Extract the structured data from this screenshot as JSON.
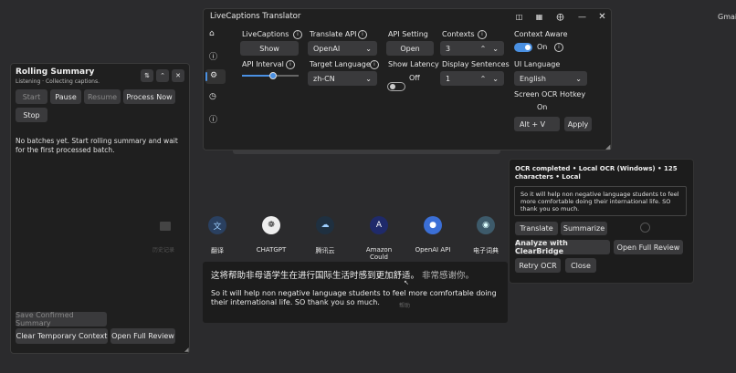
{
  "desktop": {
    "corner_text": "Gmai"
  },
  "translator": {
    "title": "LiveCaptions Translator",
    "livecaptions_label": "LiveCaptions",
    "livecaptions_button": "Show",
    "translate_api_label": "Translate API",
    "translate_api_value": "OpenAI",
    "api_setting_label": "API Setting",
    "api_setting_button": "Open",
    "contexts_label": "Contexts",
    "contexts_value": "3",
    "context_aware_label": "Context Aware",
    "context_aware_state": "On",
    "api_interval_label": "API Interval",
    "api_interval_level": 0.55,
    "target_language_label": "Target Language",
    "target_language_value": "zh-CN",
    "show_latency_label": "Show Latency",
    "show_latency_state": "Off",
    "display_sentences_label": "Display Sentences",
    "display_sentences_value": "1",
    "ui_language_label": "UI Language",
    "ui_language_value": "English",
    "screen_ocr_label": "Screen OCR Hotkey",
    "screen_ocr_state": "On",
    "hotkey_value": "Alt + V",
    "apply_button": "Apply"
  },
  "rolling": {
    "title": "Rolling Summary",
    "status": "Listening · Collecting captions.",
    "start": "Start",
    "pause": "Pause",
    "resume": "Resume",
    "process_now": "Process Now",
    "stop": "Stop",
    "empty_message": "No batches yet. Start rolling summary and wait for the first processed batch.",
    "faded_text": "历史记录",
    "save_confirmed": "Save Confirmed Summary",
    "clear_temp": "Clear Temporary Context",
    "open_full_review": "Open Full Review"
  },
  "taskbar": {
    "items": [
      {
        "label": "翻译",
        "icon": "translate-icon"
      },
      {
        "label": "CHATGPT",
        "icon": "chatgpt-icon"
      },
      {
        "label": "腾讯云",
        "icon": "tencent-cloud-icon"
      },
      {
        "label": "Amazon Could",
        "icon": "amazon-icon"
      },
      {
        "label": "OpenAI API",
        "icon": "openai-icon"
      },
      {
        "label": "电子词典",
        "icon": "dictionary-icon"
      }
    ]
  },
  "caption": {
    "zh_main": "这将帮助非母语学生在进行国际生活时感到更加舒适。",
    "zh_extra": "非常感谢你。",
    "en": "So it will help non negative language students to feel more comfortable doing their international life. SO thank you so much.",
    "faded_text": "帮助"
  },
  "ocr": {
    "title": "OCR completed • Local OCR (Windows) • 125 characters • Local",
    "text": "So it will help non negative language students to feel more comfortable doing their international life. SO thank you so much.",
    "translate": "Translate",
    "summarize": "Summarize",
    "analyze": "Analyze with ClearBridge",
    "open_full_review": "Open Full Review",
    "retry": "Retry OCR",
    "close": "Close"
  }
}
